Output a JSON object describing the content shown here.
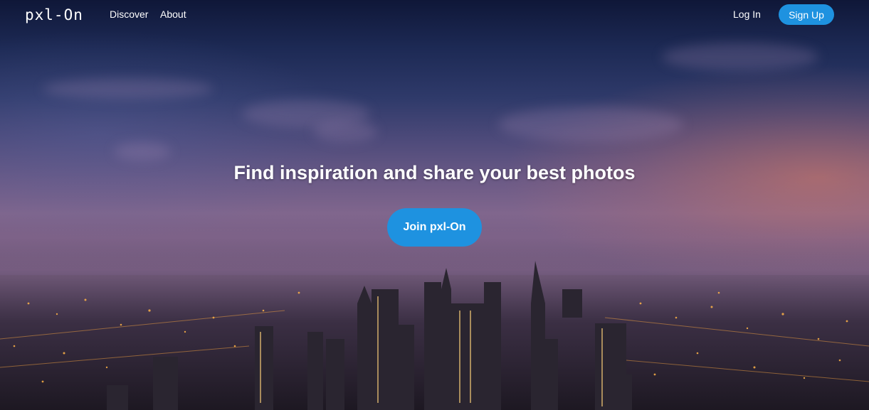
{
  "nav": {
    "logo": "pxl-On",
    "links": [
      {
        "label": "Discover"
      },
      {
        "label": "About"
      }
    ],
    "login_label": "Log In",
    "signup_label": "Sign Up"
  },
  "hero": {
    "headline": "Find inspiration and share your best photos",
    "cta_label": "Join pxl-On",
    "background": "city-skyline-dusk-image"
  },
  "colors": {
    "accent": "#1e92e0",
    "text": "#ffffff"
  }
}
